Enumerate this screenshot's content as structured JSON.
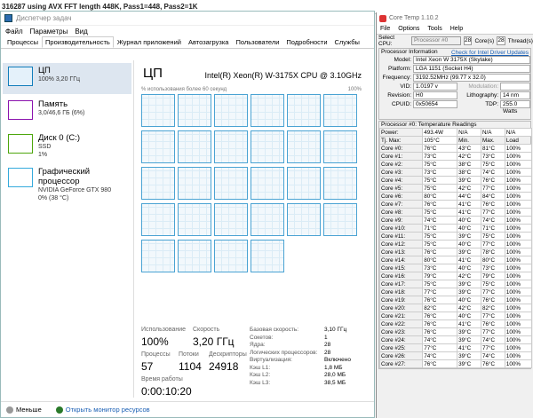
{
  "background": {
    "text": "316287 using AVX FFT length 448K, Pass1=448, Pass2=1K"
  },
  "taskmanager": {
    "title": "Диспетчер задач",
    "menu": [
      "Файл",
      "Параметры",
      "Вид"
    ],
    "tabs": [
      "Процессы",
      "Производительность",
      "Журнал приложений",
      "Автозагрузка",
      "Пользователи",
      "Подробности",
      "Службы"
    ],
    "active_tab": 1,
    "resources": [
      {
        "name": "ЦП",
        "sub": [
          "100%  3,20 ГГц"
        ],
        "color": "#117dbb",
        "selected": true
      },
      {
        "name": "Память",
        "sub": [
          "3,0/46,6 ГБ (6%)"
        ],
        "color": "#8b12ae",
        "selected": false
      },
      {
        "name": "Диск 0 (C:)",
        "sub": [
          "SSD",
          "1%"
        ],
        "color": "#4da60c",
        "selected": false
      },
      {
        "name": "Графический процессор",
        "sub": [
          "NVIDIA GeForce GTX 980",
          "0% (38 °C)"
        ],
        "color": "#34aadc",
        "selected": false
      }
    ],
    "cpu": {
      "title": "ЦП",
      "model": "Intel(R) Xeon(R) W-3175X CPU @ 3.10GHz",
      "util_label": "% использования более 60 секунд",
      "util_max": "100%",
      "core_count": 28,
      "stats": {
        "usage_label": "Использование",
        "usage": "100%",
        "speed_label": "Скорость",
        "speed": "3,20 ГГц",
        "proc_label": "Процессы",
        "proc": "57",
        "threads_label": "Потоки",
        "threads": "1104",
        "handles_label": "Дескрипторы",
        "handles": "24918",
        "uptime_label": "Время работы",
        "uptime": "0:00:10:20"
      },
      "details": [
        {
          "k": "Базовая скорость:",
          "v": "3,10 ГГц"
        },
        {
          "k": "Сокетов:",
          "v": "1"
        },
        {
          "k": "Ядра:",
          "v": "28"
        },
        {
          "k": "Логических процессоров:",
          "v": "28"
        },
        {
          "k": "Виртуализация:",
          "v": "Включено"
        },
        {
          "k": "Кэш L1:",
          "v": "1,8 МБ"
        },
        {
          "k": "Кэш L2:",
          "v": "28,0 МБ"
        },
        {
          "k": "Кэш L3:",
          "v": "38,5 МБ"
        }
      ]
    },
    "bottom": {
      "less": "Меньше",
      "monitor": "Открыть монитор ресурсов"
    }
  },
  "coretemp": {
    "title": "Core Temp 1.10.2",
    "menu": [
      "File",
      "Options",
      "Tools",
      "Help"
    ],
    "select_label": "Select CPU:",
    "select_value": "Processor #0",
    "cores": "28",
    "cores_label": "Core(s)",
    "threads": "28",
    "threads_label": "Thread(s)",
    "info_title": "Processor Information",
    "update_link": "Check for Intel Driver Updates",
    "model_label": "Model:",
    "model": "Intel Xeon W 3175X (Skylake)",
    "platform_label": "Platform:",
    "platform": "LGA 1151 (Socket H4)",
    "freq_label": "Frequency:",
    "freq": "3192.52MHz (99.77 x 32.0)",
    "vid_label": "VID:",
    "vid": "1.0197 v",
    "mod_label": "Modulation:",
    "rev_label": "Revision:",
    "rev": "H0",
    "litho_label": "Lithography:",
    "litho": "14 nm",
    "cpuid_label": "CPUID:",
    "cpuid": "0x50654",
    "tdp_label": "TDP:",
    "tdp": "255.0 Watts",
    "temp_title": "Processor #0: Temperature Readings",
    "power_label": "Power:",
    "power": "493.4W",
    "na": "N/A",
    "tjmax_label": "Tj. Max:",
    "tjmax": "105°C",
    "hdr": [
      "Min.",
      "Max.",
      "Load"
    ],
    "rows": [
      [
        "Core #0:",
        "76°C",
        "43°C",
        "81°C",
        "100%"
      ],
      [
        "Core #1:",
        "73°C",
        "42°C",
        "73°C",
        "100%"
      ],
      [
        "Core #2:",
        "75°C",
        "38°C",
        "75°C",
        "100%"
      ],
      [
        "Core #3:",
        "73°C",
        "38°C",
        "74°C",
        "100%"
      ],
      [
        "Core #4:",
        "75°C",
        "39°C",
        "76°C",
        "100%"
      ],
      [
        "Core #5:",
        "75°C",
        "42°C",
        "77°C",
        "100%"
      ],
      [
        "Core #6:",
        "80°C",
        "44°C",
        "84°C",
        "100%"
      ],
      [
        "Core #7:",
        "76°C",
        "41°C",
        "76°C",
        "100%"
      ],
      [
        "Core #8:",
        "75°C",
        "41°C",
        "77°C",
        "100%"
      ],
      [
        "Core #9:",
        "74°C",
        "40°C",
        "74°C",
        "100%"
      ],
      [
        "Core #10:",
        "71°C",
        "40°C",
        "71°C",
        "100%"
      ],
      [
        "Core #11:",
        "75°C",
        "39°C",
        "75°C",
        "100%"
      ],
      [
        "Core #12:",
        "75°C",
        "40°C",
        "77°C",
        "100%"
      ],
      [
        "Core #13:",
        "76°C",
        "39°C",
        "78°C",
        "100%"
      ],
      [
        "Core #14:",
        "80°C",
        "41°C",
        "80°C",
        "100%"
      ],
      [
        "Core #15:",
        "73°C",
        "40°C",
        "73°C",
        "100%"
      ],
      [
        "Core #16:",
        "79°C",
        "42°C",
        "79°C",
        "100%"
      ],
      [
        "Core #17:",
        "75°C",
        "39°C",
        "75°C",
        "100%"
      ],
      [
        "Core #18:",
        "77°C",
        "39°C",
        "77°C",
        "100%"
      ],
      [
        "Core #19:",
        "76°C",
        "40°C",
        "76°C",
        "100%"
      ],
      [
        "Core #20:",
        "82°C",
        "42°C",
        "82°C",
        "100%"
      ],
      [
        "Core #21:",
        "76°C",
        "40°C",
        "77°C",
        "100%"
      ],
      [
        "Core #22:",
        "76°C",
        "41°C",
        "76°C",
        "100%"
      ],
      [
        "Core #23:",
        "76°C",
        "39°C",
        "77°C",
        "100%"
      ],
      [
        "Core #24:",
        "74°C",
        "39°C",
        "74°C",
        "100%"
      ],
      [
        "Core #25:",
        "77°C",
        "41°C",
        "77°C",
        "100%"
      ],
      [
        "Core #26:",
        "74°C",
        "39°C",
        "74°C",
        "100%"
      ],
      [
        "Core #27:",
        "76°C",
        "39°C",
        "76°C",
        "100%"
      ]
    ]
  }
}
